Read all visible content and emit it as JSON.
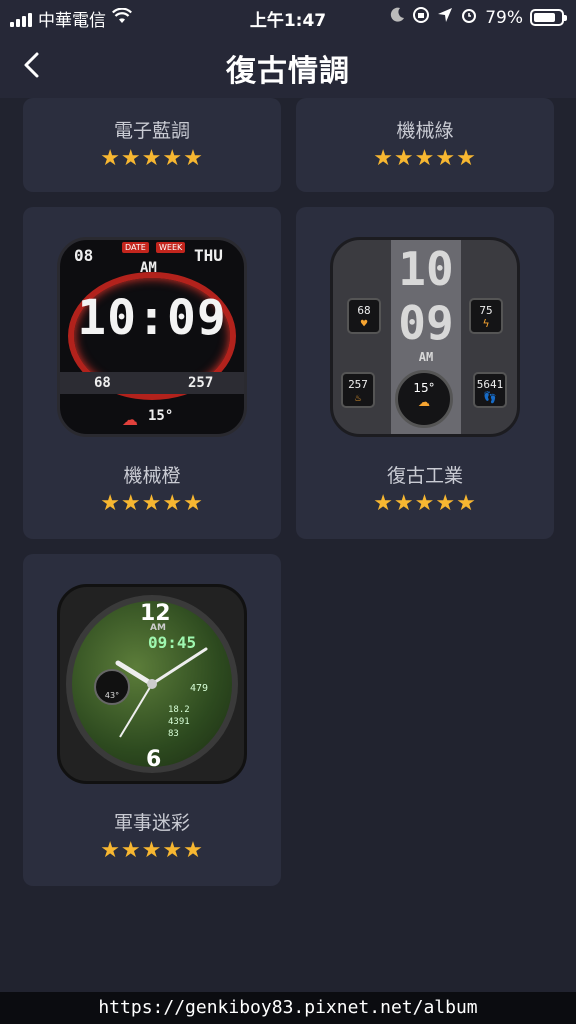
{
  "status_bar": {
    "carrier": "中華電信",
    "time": "上午1:47",
    "battery": "79%",
    "battery_level": 0.79
  },
  "header": {
    "title": "復古情調",
    "back_icon": "chevron-left-icon"
  },
  "cards": [
    {
      "name": "電子藍調",
      "stars": "★★★★★"
    },
    {
      "name": "機械綠",
      "stars": "★★★★★"
    },
    {
      "name": "機械橙",
      "stars": "★★★★★"
    },
    {
      "name": "復古工業",
      "stars": "★★★★★"
    },
    {
      "name": "軍事迷彩",
      "stars": "★★★★★"
    }
  ],
  "faces": {
    "orange": {
      "date": "08",
      "day": "THU",
      "ampm": "AM",
      "time": "10:09",
      "left": "68",
      "right": "257",
      "temp": "15°",
      "date_tag": "DATE",
      "week_tag": "WEEK"
    },
    "industrial": {
      "hour": "10",
      "minute": "09",
      "ampm": "AM",
      "hr": "68",
      "power": "75",
      "kcal": "257",
      "steps": "5641",
      "temp": "15°"
    },
    "military": {
      "twelve": "12",
      "six": "6",
      "time": "09:45",
      "ampm": "AM",
      "weather": "43°",
      "steps": "479",
      "dist": "18.2",
      "kcal": "4391",
      "hr": "83"
    }
  },
  "footer": {
    "url": "https://genkiboy83.pixnet.net/album"
  }
}
